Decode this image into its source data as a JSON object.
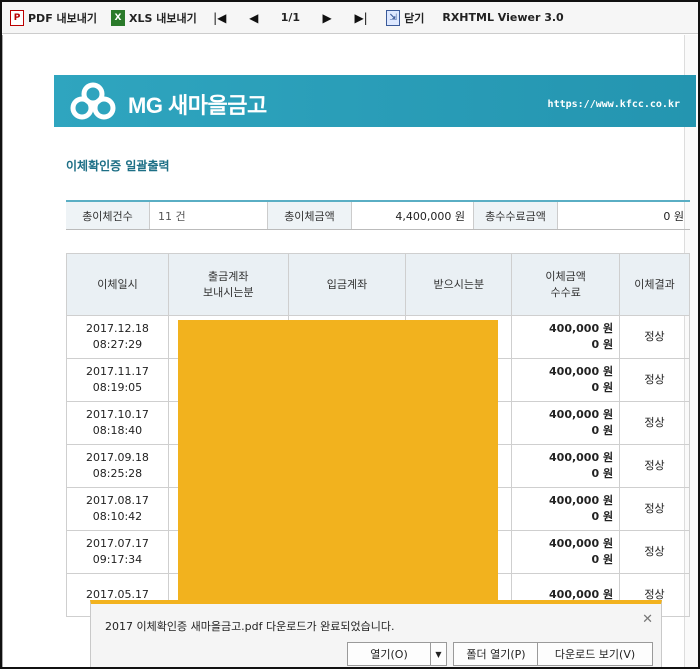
{
  "toolbar": {
    "pdf_export": "PDF 내보내기",
    "xls_export": "XLS 내보내기",
    "page_indicator": "1/1",
    "close": "닫기",
    "viewer_title": "RXHTML Viewer 3.0"
  },
  "banner": {
    "logo_text": "MG 새마을금고",
    "url": "https://www.kfcc.co.kr",
    "color": "#2fa5bf"
  },
  "report": {
    "title": "이체확인증 일괄출력"
  },
  "summary": {
    "count_label": "총이체건수",
    "count_value": "11 건",
    "amount_label": "총이체금액",
    "amount_value": "4,400,000 원",
    "fee_label": "총수수료금액",
    "fee_value": "0 원"
  },
  "table": {
    "headers": {
      "date": "이체일시",
      "from_line1": "출금계좌",
      "from_line2": "보내시는분",
      "to_account": "입금계좌",
      "recipient": "받으시는분",
      "amount_line1": "이체금액",
      "amount_line2": "수수료",
      "result": "이체결과"
    },
    "rows": [
      {
        "date": "2017.12.18",
        "time": "08:27:29",
        "amount": "400,000 원",
        "fee": "0 원",
        "result": "정상"
      },
      {
        "date": "2017.11.17",
        "time": "08:19:05",
        "amount": "400,000 원",
        "fee": "0 원",
        "result": "정상"
      },
      {
        "date": "2017.10.17",
        "time": "08:18:40",
        "amount": "400,000 원",
        "fee": "0 원",
        "result": "정상"
      },
      {
        "date": "2017.09.18",
        "time": "08:25:28",
        "amount": "400,000 원",
        "fee": "0 원",
        "result": "정상"
      },
      {
        "date": "2017.08.17",
        "time": "08:10:42",
        "amount": "400,000 원",
        "fee": "0 원",
        "result": "정상"
      },
      {
        "date": "2017.07.17",
        "time": "09:17:34",
        "amount": "400,000 원",
        "fee": "0 원",
        "result": "정상"
      },
      {
        "date": "2017.05.17",
        "time": "",
        "amount": "400,000 원",
        "fee": "",
        "result": "정상"
      }
    ]
  },
  "download": {
    "message": "2017 이체확인증 새마을금고.pdf 다운로드가 완료되었습니다.",
    "open": "열기(O)",
    "open_folder": "폴더 열기(P)",
    "view_downloads": "다운로드 보기(V)",
    "accent": "#f2b21e"
  }
}
